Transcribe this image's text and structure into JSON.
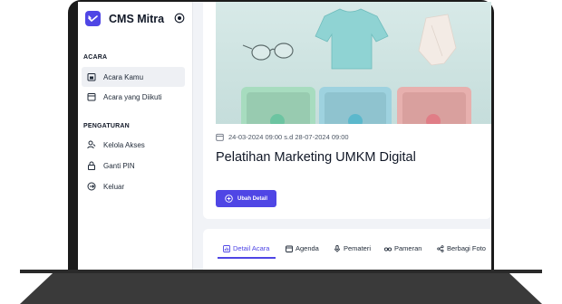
{
  "sidebar": {
    "brand": "CMS Mitra",
    "sections": [
      {
        "label": "ACARA"
      },
      {
        "label": "PENGATURAN"
      }
    ],
    "items": [
      {
        "label": "Acara Kamu",
        "icon": "calendar-check-icon",
        "active": true
      },
      {
        "label": "Acara yang Diikuti",
        "icon": "calendar-icon",
        "active": false
      },
      {
        "label": "Kelola Akses",
        "icon": "users-icon",
        "active": false
      },
      {
        "label": "Ganti PIN",
        "icon": "lock-icon",
        "active": false
      },
      {
        "label": "Keluar",
        "icon": "logout-icon",
        "active": false
      }
    ]
  },
  "event": {
    "date_range": "24-03-2024 09:00 s.d 28-07-2024 09:00",
    "title": "Pelatihan Marketing UMKM Digital",
    "edit_button": "Ubah Detail"
  },
  "tabs": [
    {
      "label": "Detail Acara",
      "active": true
    },
    {
      "label": "Agenda"
    },
    {
      "label": "Pemateri"
    },
    {
      "label": "Pameran"
    },
    {
      "label": "Berbagi Foto"
    }
  ],
  "colors": {
    "accent": "#4f46e5",
    "banner_bg": "#cfe4e3",
    "bezel": "#1b1b1b"
  }
}
